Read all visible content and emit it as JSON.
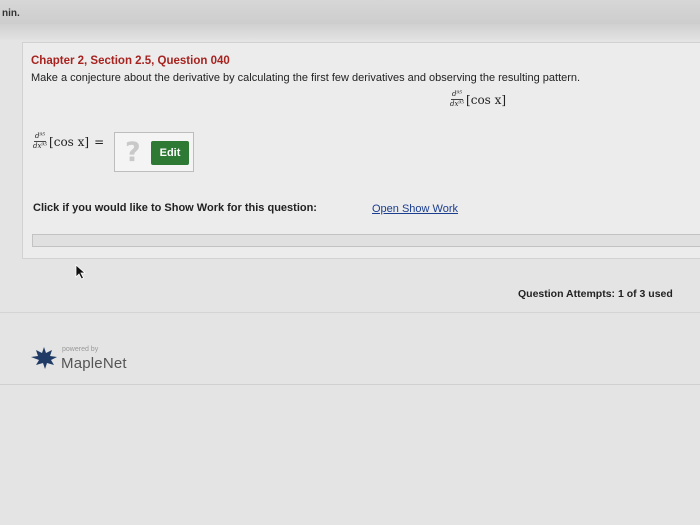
{
  "window": {
    "title_fragment": "nin."
  },
  "question": {
    "title": "Chapter 2, Section 2.5, Question 040",
    "prompt": "Make a conjecture about the derivative by calculating the first few derivatives and observing the resulting pattern.",
    "derivative_numerator": "d⁹⁵",
    "derivative_denominator": "dx⁹⁵",
    "function": "[cos x]",
    "equals": "=",
    "answer_placeholder": "?",
    "edit_label": "Edit"
  },
  "show_work": {
    "label": "Click if you would like to Show Work for this question:",
    "link": "Open Show Work"
  },
  "attempts": "Question Attempts: 1 of 3 used",
  "footer": {
    "powered_by": "powered by",
    "brand": "MapleNet"
  },
  "colors": {
    "title": "#a6231f",
    "edit_button": "#2e7a35",
    "link": "#1b3e8f"
  }
}
